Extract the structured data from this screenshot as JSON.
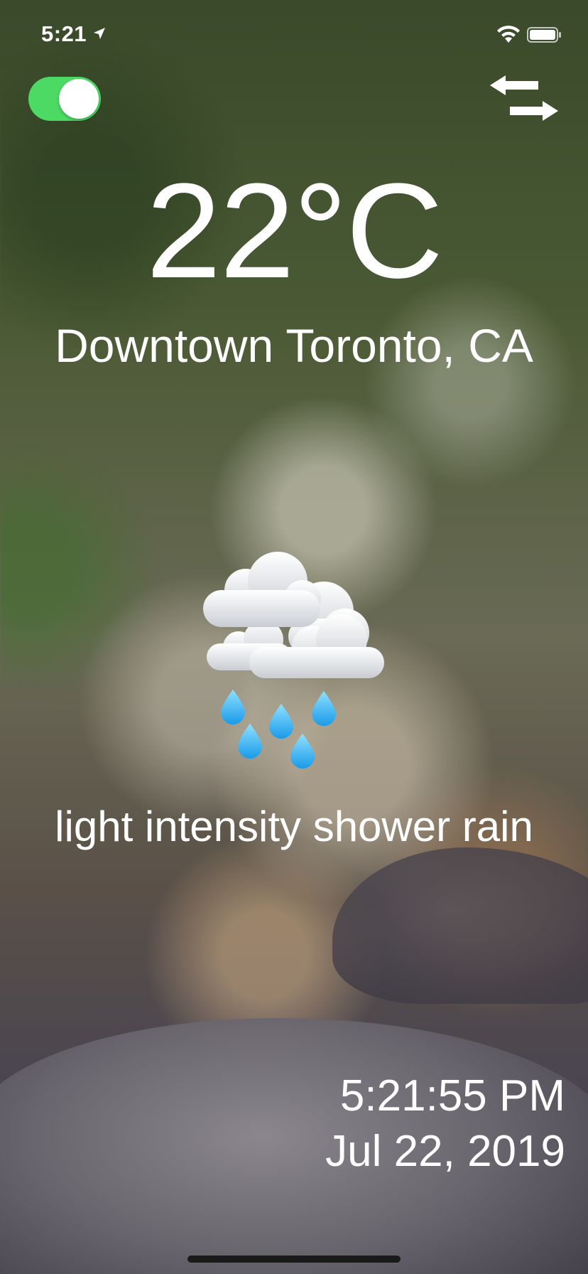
{
  "status_bar": {
    "time": "5:21",
    "icons": [
      "location-arrow-icon",
      "wifi-icon",
      "battery-icon"
    ]
  },
  "controls": {
    "toggle_state": "on",
    "toggle_color": "#4cd964",
    "swap_icon": "swap-arrows-icon"
  },
  "weather": {
    "temperature": "22°C",
    "location": "Downtown Toronto, CA",
    "icon": "rain-cloud-icon",
    "description": "light intensity shower rain"
  },
  "datetime": {
    "time": "5:21:55 PM",
    "date": "Jul 22, 2019"
  }
}
